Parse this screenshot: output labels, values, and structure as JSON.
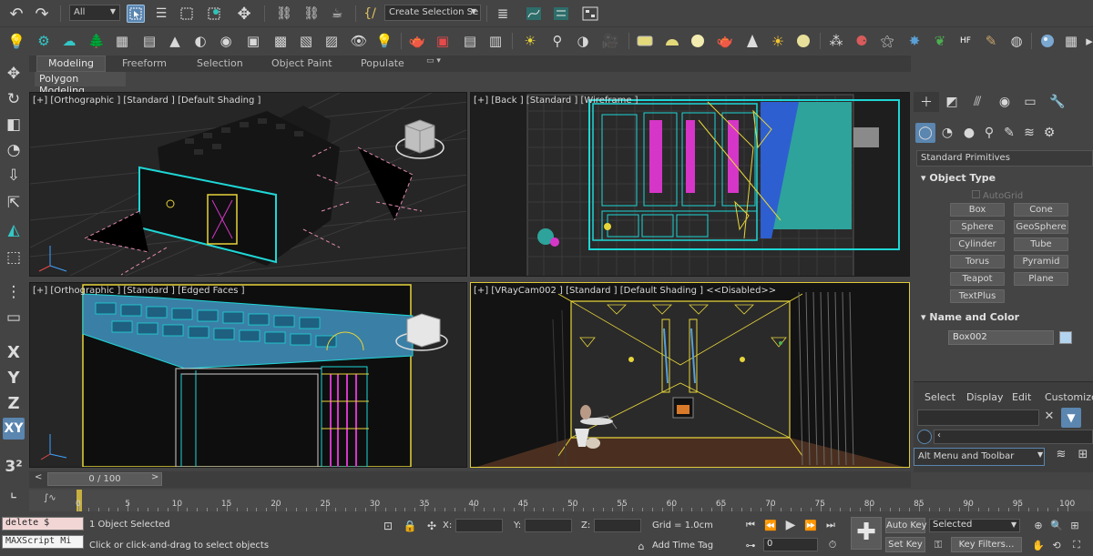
{
  "toolbar_main": {
    "filter_selected": "All",
    "selection_set_placeholder": "Create Selection Se"
  },
  "ribbon": {
    "tabs": [
      "Modeling",
      "Freeform",
      "Selection",
      "Object Paint",
      "Populate"
    ],
    "active_tab": "Modeling",
    "panel_title": "Polygon Modeling"
  },
  "left_toolbar": {
    "axis_buttons": [
      "X",
      "Y",
      "Z",
      "XY"
    ],
    "active_axis": "XY"
  },
  "viewports": {
    "top_left": {
      "label": "[+] [Orthographic ] [Standard ] [Default Shading ]"
    },
    "top_right": {
      "label": "[+] [Back ] [Standard ] [Wireframe ]"
    },
    "bottom_left": {
      "label": "[+] [Orthographic ] [Standard ] [Edged Faces ]"
    },
    "bottom_right": {
      "label": "[+] [VRayCam002 ] [Standard ] [Default Shading ]  <<Disabled>>"
    }
  },
  "command_panel": {
    "category": "Standard Primitives",
    "object_type_title": "Object Type",
    "autogrid_label": "AutoGrid",
    "primitives": [
      "Box",
      "Cone",
      "Sphere",
      "GeoSphere",
      "Cylinder",
      "Tube",
      "Torus",
      "Pyramid",
      "Teapot",
      "Plane",
      "TextPlus"
    ],
    "name_color_title": "Name and Color",
    "object_name": "Box002",
    "object_color": "#b3d4ee"
  },
  "scene_explorer": {
    "menu": [
      "Select",
      "Display",
      "Edit",
      "Customize"
    ],
    "workspace": "Alt Menu and Toolbar"
  },
  "timeline": {
    "frame_display": "0 / 100",
    "ticks": [
      0,
      5,
      10,
      15,
      20,
      25,
      30,
      35,
      40,
      45,
      50,
      55,
      60,
      65,
      70,
      75,
      80,
      85,
      90,
      95,
      100
    ]
  },
  "status": {
    "script_input": "delete $",
    "script_label": "MAXScript Mi",
    "selection_count": "1 Object Selected",
    "prompt": "Click or click-and-drag to select objects",
    "x_label": "X:",
    "y_label": "Y:",
    "z_label": "Z:",
    "grid": "Grid = 1.0cm",
    "add_time_tag": "Add Time Tag",
    "auto_key": "Auto Key",
    "set_key": "Set Key",
    "key_mode": "Selected",
    "key_filters": "Key Filters...",
    "frame_value": "0"
  },
  "colors": {
    "background": "#444444",
    "viewport_dark": "#1e1e1e",
    "wire_cyan": "#1fd6d6",
    "wire_yellow": "#e6d43a",
    "wire_magenta": "#d636c8",
    "active_border": "#e0c93a",
    "highlight_blue": "#5a86b0"
  }
}
